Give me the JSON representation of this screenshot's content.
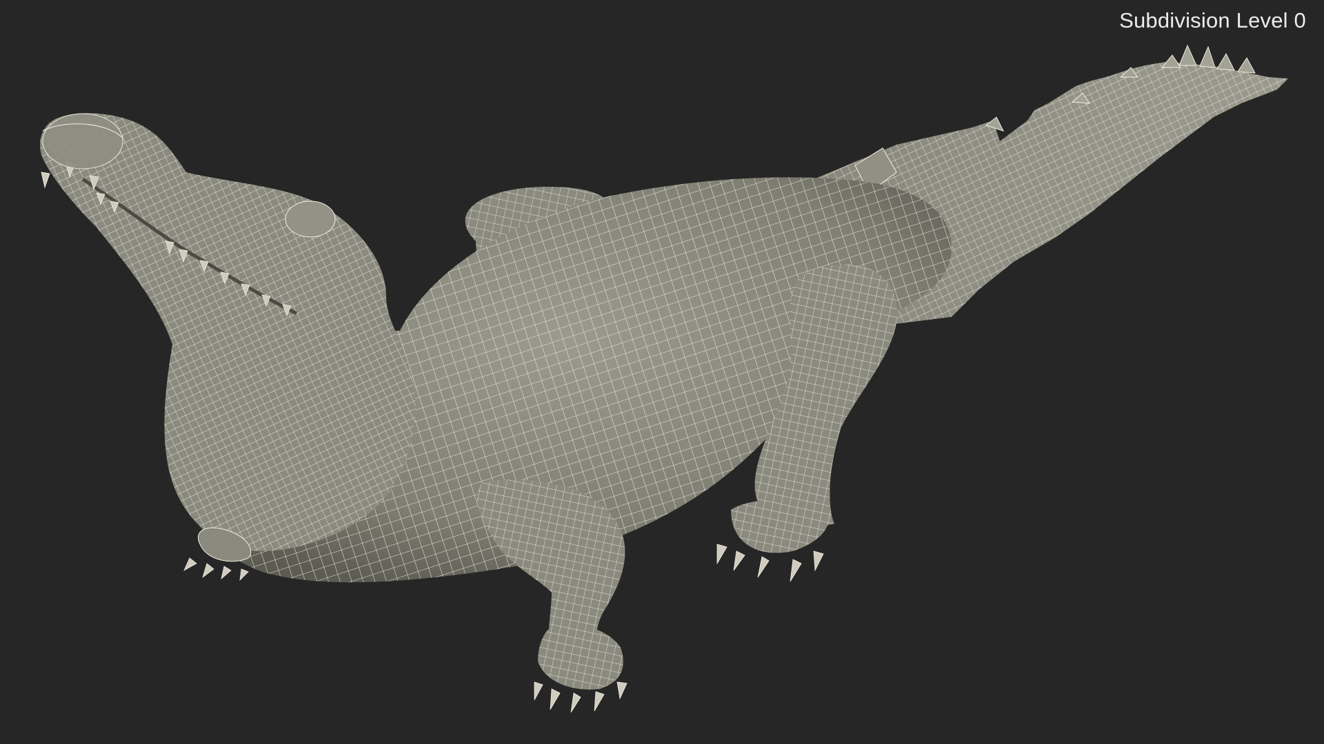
{
  "viewport": {
    "label": "Subdivision Level 0",
    "background_color": "#262626",
    "label_color": "#ececec"
  },
  "model": {
    "subject": "crocodile-wireframe-mesh",
    "surface_color": "#8a8a7e",
    "shadow_color": "#55554c",
    "wire_color": "#f2efe2"
  }
}
